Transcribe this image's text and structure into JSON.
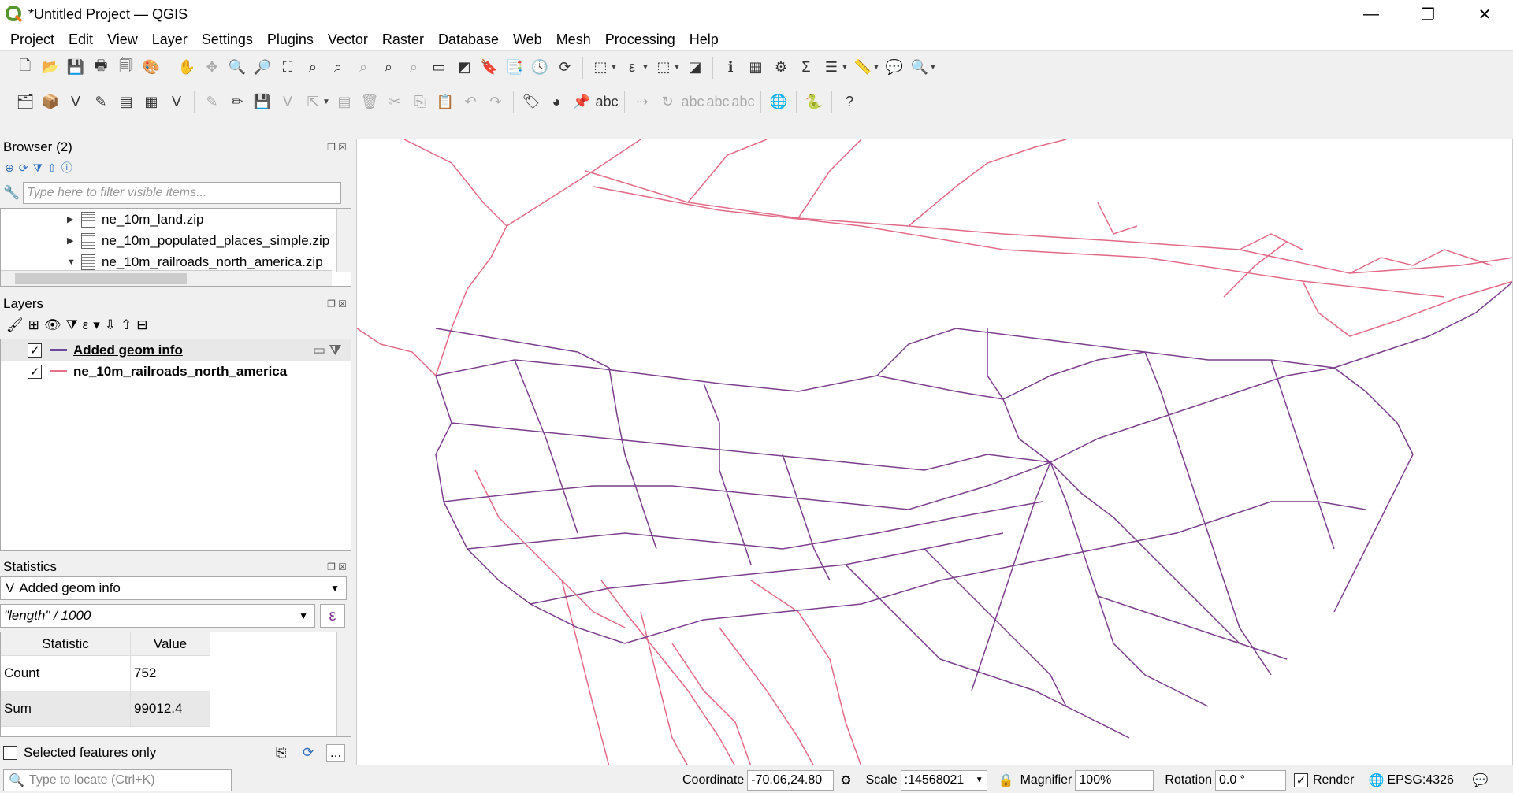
{
  "window": {
    "title": "*Untitled Project — QGIS",
    "controls": [
      "—",
      "❐",
      "✕"
    ]
  },
  "menu": [
    "Project",
    "Edit",
    "View",
    "Layer",
    "Settings",
    "Plugins",
    "Vector",
    "Raster",
    "Database",
    "Web",
    "Mesh",
    "Processing",
    "Help"
  ],
  "browser": {
    "title": "Browser (2)",
    "filter_placeholder": "Type here to filter visible items...",
    "items": [
      {
        "label": "ne_10m_land.zip",
        "expanded": false
      },
      {
        "label": "ne_10m_populated_places_simple.zip",
        "expanded": false
      },
      {
        "label": "ne_10m_railroads_north_america.zip",
        "expanded": true
      }
    ]
  },
  "layers": {
    "title": "Layers",
    "items": [
      {
        "label": "Added geom info",
        "checked": true,
        "color": "#6b4a9e"
      },
      {
        "label": "ne_10m_railroads_north_america",
        "checked": true,
        "color": "#e8708a"
      }
    ]
  },
  "statistics": {
    "title": "Statistics",
    "layer": "Added geom info",
    "expression": "\"length\" / 1000",
    "headers": [
      "Statistic",
      "Value"
    ],
    "rows": [
      {
        "statistic": "Count",
        "value": "752"
      },
      {
        "statistic": "Sum",
        "value": "99012.4"
      }
    ],
    "selected_only_label": "Selected features only"
  },
  "statusbar": {
    "locator_placeholder": "Type to locate (Ctrl+K)",
    "coordinate_label": "Coordinate",
    "coordinate_value": "-70.06,24.80",
    "scale_label": "Scale",
    "scale_value": ":14568021",
    "magnifier_label": "Magnifier",
    "magnifier_value": "100%",
    "rotation_label": "Rotation",
    "rotation_value": "0.0 °",
    "render_label": "Render",
    "crs": "EPSG:4326"
  },
  "colors": {
    "layer_geom": "#7b3f8c",
    "layer_rail": "#e36a86"
  }
}
